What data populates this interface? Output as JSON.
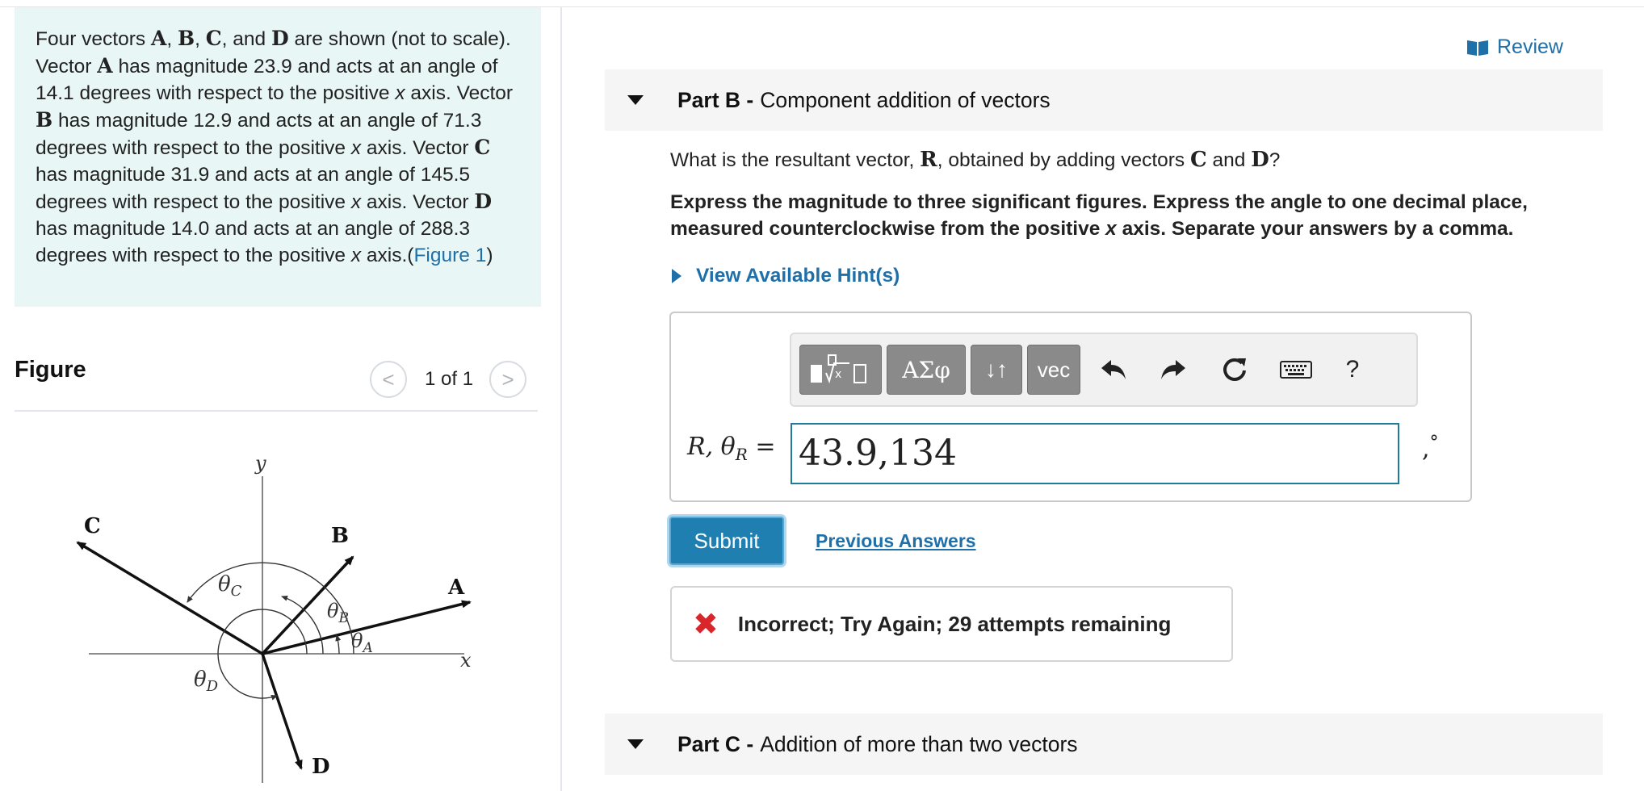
{
  "review": {
    "label": "Review",
    "icon": "book-icon"
  },
  "problem": {
    "s1": "Four vectors ",
    "vA": "A",
    "s2": ", ",
    "vB": "B",
    "s3": ", ",
    "vC": "C",
    "s4": ", and ",
    "vD": "D",
    "s5": " are shown (not to scale). Vector ",
    "vA2": "A",
    "s6": " has magnitude 23.9 and acts at an angle of 14.1 degrees with respect to the positive ",
    "x1": "x",
    "s7": " axis. Vector ",
    "vB2": "B",
    "s8": " has magnitude 12.9 and acts at an angle of 71.3 degrees with respect to the positive ",
    "x2": "x",
    "s9": " axis. Vector ",
    "vC2": "C",
    "s10": " has magnitude 31.9 and acts at an angle of 145.5 degrees with respect to the positive ",
    "x3": "x",
    "s11": " axis. Vector ",
    "vD2": "D",
    "s12": " has magnitude 14.0 and acts at an angle of 288.3 degrees with respect to the positive ",
    "x4": "x",
    "s13": " axis.(",
    "figure_link": "Figure 1",
    "s14": ")"
  },
  "figure": {
    "title": "Figure",
    "pager": "1 of 1",
    "prev_icon": "<",
    "next_icon": ">",
    "labels": {
      "y": "y",
      "x": "x",
      "A": "A",
      "B": "B",
      "C": "C",
      "D": "D",
      "thetaC": "θ",
      "thetaC_sub": "C",
      "thetaB": "θ",
      "thetaB_sub": "B",
      "thetaA": "θ",
      "thetaA_sub": "A",
      "thetaD": "θ",
      "thetaD_sub": "D"
    }
  },
  "partB": {
    "label": "Part B -",
    "title": "Component addition of vectors",
    "q1": "What is the resultant vector, ",
    "qR": "R",
    "q2": ", obtained by adding vectors ",
    "qC": "C",
    "q3": " and ",
    "qD": "D",
    "q4": "?",
    "instr1": "Express the magnitude to three significant figures. Express the angle to one decimal place, measured counterclockwise from the positive ",
    "instr_x": "x",
    "instr2": " axis. Separate your answers by a comma.",
    "hint": "View Available Hint(s)"
  },
  "toolbar": {
    "templates_icon": "templates-icon",
    "greek": "ΑΣφ",
    "arrows": "↓↑",
    "vec": "vec",
    "help": "?"
  },
  "answer": {
    "label_R": "R, θ",
    "label_sub": "R",
    "label_eq": " =",
    "value": "43.9,134",
    "units_comma": ",",
    "units_deg": "°"
  },
  "submit_label": "Submit",
  "previous_answers": "Previous Answers",
  "feedback": {
    "icon": "✖",
    "message": "Incorrect; Try Again; 29 attempts remaining"
  },
  "partC": {
    "label": "Part C -",
    "title": "Addition of more than two vectors"
  }
}
